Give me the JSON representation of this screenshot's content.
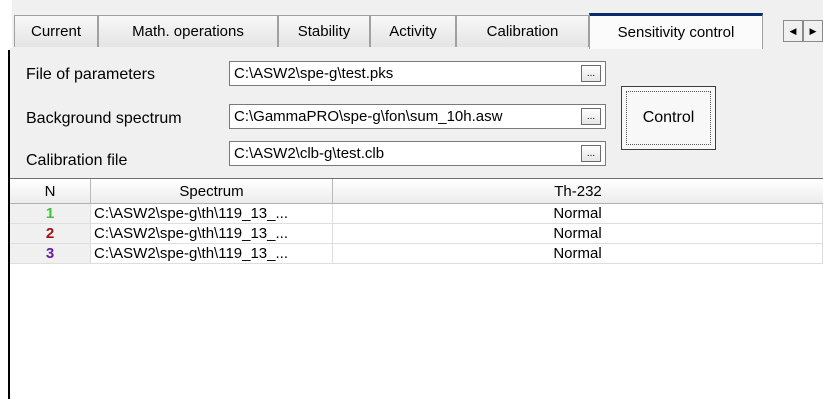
{
  "tabs": [
    {
      "label": "Current"
    },
    {
      "label": "Math. operations"
    },
    {
      "label": "Stability"
    },
    {
      "label": "Activity"
    },
    {
      "label": "Calibration"
    },
    {
      "label": "Sensitivity control",
      "active": true
    }
  ],
  "params": {
    "parameters_label": "File of parameters",
    "parameters_value": "C:\\ASW2\\spe-g\\test.pks",
    "background_label": "Background spectrum",
    "background_value": "C:\\GammaPRO\\spe-g\\fon\\sum_10h.asw",
    "calibration_label": "Calibration file",
    "calibration_value": "C:\\ASW2\\clb-g\\test.clb",
    "browse_label": "...",
    "control_label": "Control"
  },
  "table": {
    "headers": [
      "N",
      "Spectrum",
      "Th-232"
    ],
    "rows": [
      {
        "n": "1",
        "spectrum": "C:\\ASW2\\spe-g\\th\\119_13_...",
        "value": "Normal",
        "color": "#3cc43c"
      },
      {
        "n": "2",
        "spectrum": "C:\\ASW2\\spe-g\\th\\119_13_...",
        "value": "Normal",
        "color": "#a01010"
      },
      {
        "n": "3",
        "spectrum": "C:\\ASW2\\spe-g\\th\\119_13_...",
        "value": "Normal",
        "color": "#6a1b9a"
      }
    ]
  },
  "icons": {
    "scroll_left": "scroll-left-icon",
    "scroll_right": "scroll-right-icon"
  }
}
